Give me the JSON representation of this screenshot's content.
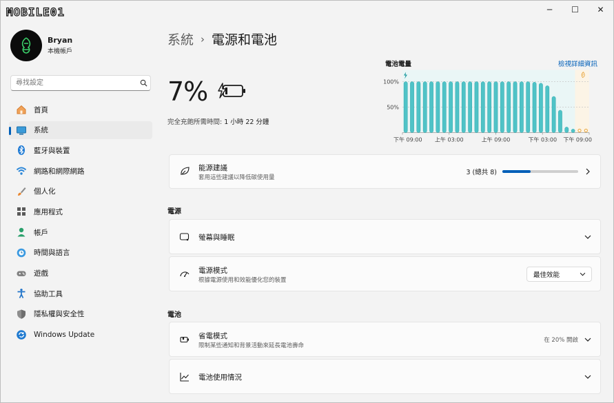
{
  "window": {
    "logo_text": "MOBILE01",
    "minimize_label": "─",
    "maximize_label": "☐",
    "close_label": "✕"
  },
  "profile": {
    "name": "Bryan",
    "account_type": "本機帳戶"
  },
  "search": {
    "placeholder": "尋找設定"
  },
  "nav": [
    {
      "label": "首頁",
      "icon": "home-icon",
      "active": false
    },
    {
      "label": "系統",
      "icon": "system-icon",
      "active": true
    },
    {
      "label": "藍牙與裝置",
      "icon": "bluetooth-icon",
      "active": false
    },
    {
      "label": "網路和網際網路",
      "icon": "wifi-icon",
      "active": false
    },
    {
      "label": "個人化",
      "icon": "brush-icon",
      "active": false
    },
    {
      "label": "應用程式",
      "icon": "apps-icon",
      "active": false
    },
    {
      "label": "帳戶",
      "icon": "account-icon",
      "active": false
    },
    {
      "label": "時間與語言",
      "icon": "globe-clock-icon",
      "active": false
    },
    {
      "label": "遊戲",
      "icon": "gamepad-icon",
      "active": false
    },
    {
      "label": "協助工具",
      "icon": "accessibility-icon",
      "active": false
    },
    {
      "label": "隱私權與安全性",
      "icon": "shield-icon",
      "active": false
    },
    {
      "label": "Windows Update",
      "icon": "update-icon",
      "active": false
    }
  ],
  "breadcrumb": {
    "parent": "系統",
    "separator": "›",
    "current": "電源和電池"
  },
  "battery": {
    "percent": "7%",
    "charge_time_label": "完全充飽所需時間:",
    "charge_time_value": "1 小時 22 分鐘"
  },
  "chart_header": {
    "title": "電池電量",
    "link": "檢視詳細資訊"
  },
  "chart_data": {
    "type": "bar",
    "ylabels": [
      "100%",
      "50%"
    ],
    "ylim": [
      0,
      100
    ],
    "xticks": [
      "下午 09:00",
      "上午 03:00",
      "上午 09:00",
      "下午 03:00",
      "下午 09:00"
    ],
    "values": [
      100,
      100,
      100,
      100,
      100,
      100,
      100,
      100,
      100,
      100,
      100,
      100,
      100,
      100,
      100,
      100,
      100,
      100,
      100,
      100,
      99,
      97,
      92,
      71,
      44,
      11,
      7,
      7,
      7
    ],
    "charging_bars": 2,
    "colors": {
      "bar": "#4fc3c7",
      "bar_stroke": "#1d9aa0",
      "charging": "#e8a43a",
      "grid": "#c8c8c8"
    }
  },
  "recommendations": {
    "title": "能源建議",
    "subtitle": "套用這些建議以降低碳使用量",
    "count": "3 (總共 8)",
    "progress": 0.375
  },
  "power_section": {
    "title": "電源"
  },
  "screen_sleep": {
    "title": "螢幕與睡眠"
  },
  "power_mode": {
    "title": "電源模式",
    "subtitle": "根據電源使用和效能優化您的裝置",
    "selected": "最佳效能"
  },
  "battery_section": {
    "title": "電池"
  },
  "saver": {
    "title": "省電模式",
    "subtitle": "限制某些通知和背景活動來延長電池壽命",
    "status": "在 20% 開啟"
  },
  "usage": {
    "title": "電池使用情況"
  },
  "colors": {
    "accent": "#005fb8",
    "background": "#f3f3f3",
    "card": "#fbfbfb"
  }
}
